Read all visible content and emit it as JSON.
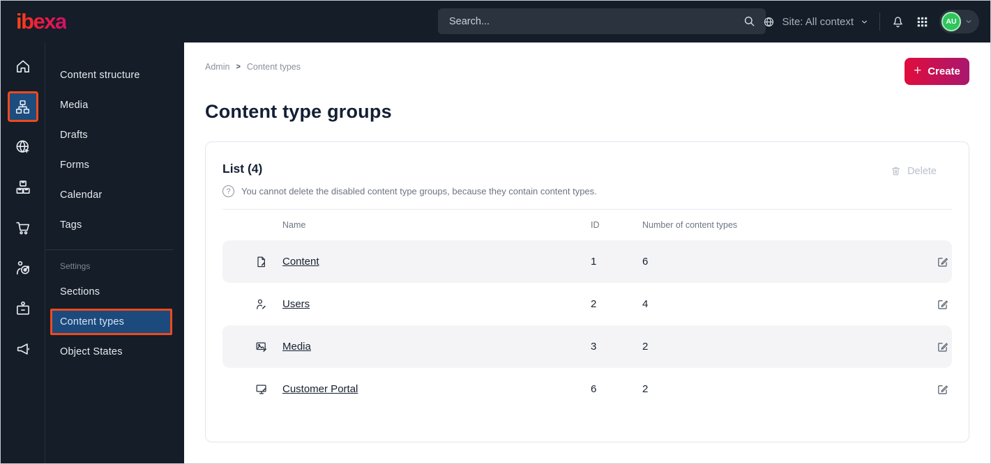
{
  "colors": {
    "topbar_bg": "#141d28",
    "active_blue": "#1d4c7f",
    "annotation_orange": "#ef4a1c",
    "create_gradient_start": "#e00d3d",
    "create_gradient_end": "#a9176e",
    "avatar_green": "#2fc45c",
    "row_stripe": "#f4f4f7"
  },
  "topbar": {
    "logo_text": "ibexa",
    "search_placeholder": "Search...",
    "site_selector": "Site: All context",
    "avatar_initials": "AU"
  },
  "icon_rail": {
    "items": [
      {
        "icon": "home-icon",
        "active": false
      },
      {
        "icon": "sitemap-icon",
        "active": true
      },
      {
        "icon": "globe-cursor-icon",
        "active": false
      },
      {
        "icon": "packages-icon",
        "active": false
      },
      {
        "icon": "cart-icon",
        "active": false
      },
      {
        "icon": "audience-target-icon",
        "active": false
      },
      {
        "icon": "id-badge-icon",
        "active": false
      },
      {
        "icon": "megaphone-icon",
        "active": false
      }
    ]
  },
  "sidebar": {
    "items": [
      "Content structure",
      "Media",
      "Drafts",
      "Forms",
      "Calendar",
      "Tags"
    ],
    "section_label": "Settings",
    "section_items": [
      "Sections",
      "Content types",
      "Object States"
    ],
    "active_item": "Content types"
  },
  "main": {
    "breadcrumb": [
      "Admin",
      "Content types"
    ],
    "create_button": "Create",
    "page_title": "Content type groups",
    "list_card": {
      "title": "List (4)",
      "info": "You cannot delete the disabled content type groups, because they contain content types.",
      "delete_button": "Delete",
      "columns": [
        "Name",
        "ID",
        "Number of content types"
      ],
      "rows": [
        {
          "icon": "file-icon",
          "name": "Content",
          "id": "1",
          "count": "6"
        },
        {
          "icon": "user-icon",
          "name": "Users",
          "id": "2",
          "count": "4"
        },
        {
          "icon": "image-icon",
          "name": "Media",
          "id": "3",
          "count": "2"
        },
        {
          "icon": "monitor-icon",
          "name": "Customer Portal",
          "id": "6",
          "count": "2"
        }
      ]
    }
  }
}
